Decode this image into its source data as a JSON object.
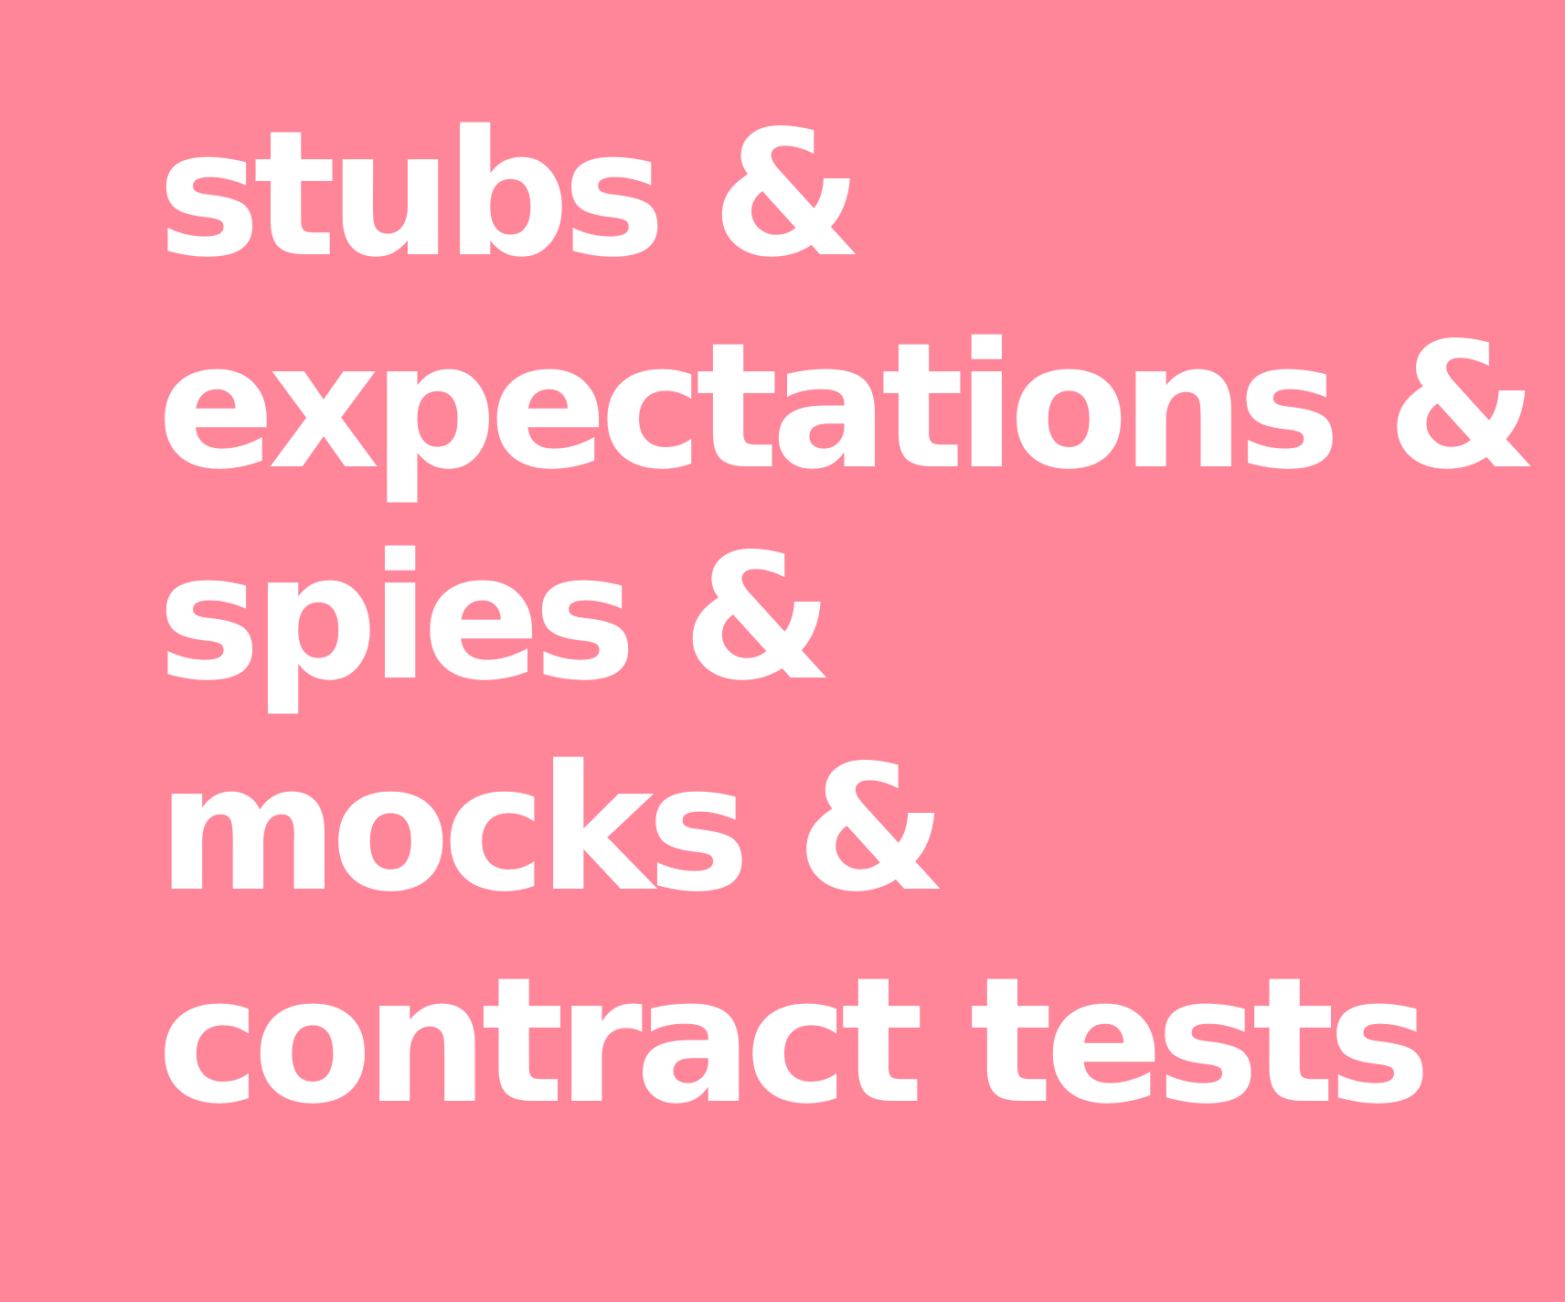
{
  "colors": {
    "background": "#ff8599",
    "text": "#ffffff"
  },
  "lines": [
    "stubs &",
    "expectations &",
    "spies &",
    "mocks &",
    "contract tests"
  ]
}
